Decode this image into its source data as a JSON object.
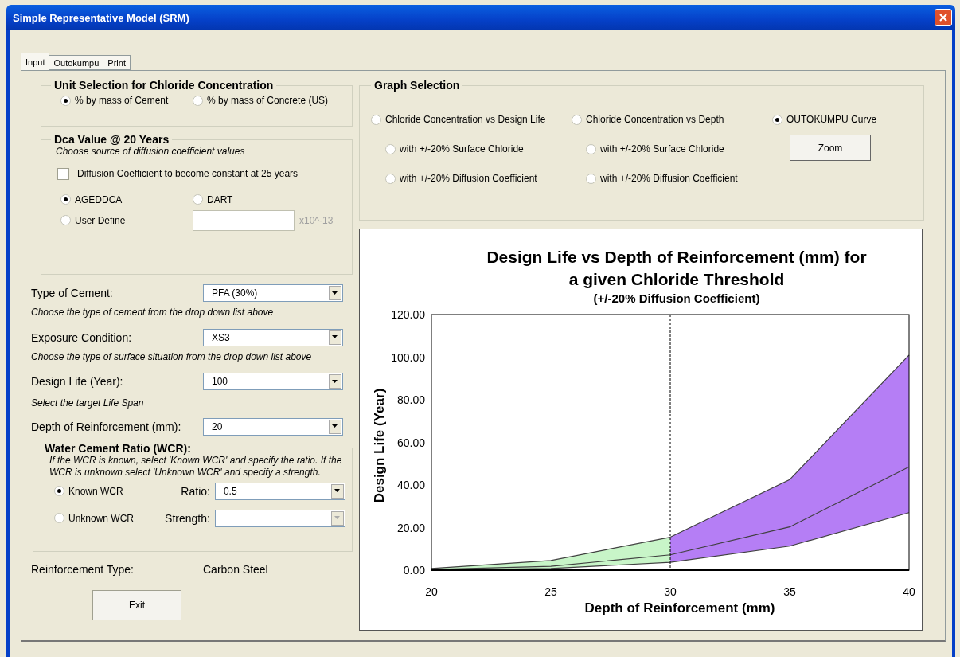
{
  "window": {
    "title": "Simple Representative Model (SRM)"
  },
  "tabs": [
    {
      "label": "Input",
      "selected": true
    },
    {
      "label": "Outokumpu",
      "selected": false
    },
    {
      "label": "Print",
      "selected": false
    }
  ],
  "unit_selection": {
    "title": "Unit Selection for Chloride Concentration",
    "options": [
      {
        "label": "% by mass of Cement",
        "selected": true
      },
      {
        "label": "% by mass of Concrete (US)",
        "selected": false
      }
    ]
  },
  "dca": {
    "title": "Dca Value @ 20 Years",
    "hint": "Choose source of diffusion coefficient values",
    "constant_checkbox": {
      "label": "Diffusion Coefficient to become constant at 25 years",
      "checked": false
    },
    "options": [
      {
        "label": "AGEDDCA",
        "selected": true
      },
      {
        "label": "DART",
        "selected": false
      },
      {
        "label": "User Define",
        "selected": false
      }
    ],
    "unit": "x10^-13"
  },
  "fields": [
    {
      "label": "Type of Cement:",
      "value": "PFA (30%)",
      "hint": "Choose the type of cement from the drop down list above"
    },
    {
      "label": "Exposure Condition:",
      "value": "XS3",
      "hint": "Choose the type of surface situation from the drop down list above"
    },
    {
      "label": "Design Life (Year):",
      "value": "100",
      "hint": "Select the target Life Span"
    },
    {
      "label": "Depth of Reinforcement (mm):",
      "value": "20"
    }
  ],
  "wcr": {
    "title": "Water Cement Ratio (WCR):",
    "hint": "If the WCR is known, select 'Known WCR' and specify the ratio. If the WCR is unknown select 'Unknown WCR' and specify a strength.",
    "options": [
      {
        "label": "Known WCR",
        "selected": true,
        "field_label": "Ratio:",
        "value": "0.5",
        "disabled": false
      },
      {
        "label": "Unknown WCR",
        "selected": false,
        "field_label": "Strength:",
        "disabled": true
      }
    ]
  },
  "reinforcement": {
    "label": "Reinforcement Type:",
    "value": "Carbon Steel"
  },
  "exit_button": "Exit",
  "graph_selection": {
    "title": "Graph Selection",
    "groups": [
      {
        "label": "Chloride Concentration vs Design Life",
        "selected": false,
        "children": [
          {
            "label": "with +/-20% Surface Chloride",
            "selected": false
          },
          {
            "label": "with +/-20% Diffusion Coefficient",
            "selected": false
          }
        ]
      },
      {
        "label": "Chloride Concentration vs Depth",
        "selected": false,
        "children": [
          {
            "label": "with +/-20% Surface Chloride",
            "selected": false
          },
          {
            "label": "with +/-20% Diffusion Coefficient",
            "selected": false
          }
        ]
      },
      {
        "label": "OUTOKUMPU Curve",
        "selected": true
      }
    ],
    "zoom_button": "Zoom"
  },
  "chart": {
    "chart_data": {
      "type": "area",
      "title": "Design Life vs Depth of Reinforcement (mm) for a given Chloride Threshold",
      "subtitle": "(+/-20% Diffusion Coefficient)",
      "xlabel": "Depth of Reinforcement (mm)",
      "ylabel": "Design Life (Year)",
      "x": [
        20,
        25,
        30,
        35,
        40
      ],
      "series": [
        {
          "type": "area",
          "color": "#c8f5c8",
          "values": [
            0.8,
            4.5,
            15.5,
            null,
            null
          ]
        },
        {
          "type": "area",
          "color": "#b57ef5",
          "values": [
            null,
            null,
            15.5,
            42.5,
            101
          ]
        },
        {
          "type": "line",
          "color": "#404040",
          "values": [
            0.3,
            1.8,
            7.2,
            20.3,
            48.5
          ]
        },
        {
          "type": "line",
          "color": "#404040",
          "values": [
            0.1,
            0.8,
            3.7,
            11.3,
            27
          ]
        }
      ],
      "xlim": [
        20,
        40
      ],
      "ylim": [
        0,
        120
      ],
      "xticks": [
        20,
        25,
        30,
        35,
        40
      ],
      "yticks": [
        {
          "value": 0,
          "label": "0.00"
        },
        {
          "value": 20,
          "label": "20.00"
        },
        {
          "value": 40,
          "label": "40.00"
        },
        {
          "value": 60,
          "label": "60.00"
        },
        {
          "value": 80,
          "label": "80.00"
        },
        {
          "value": 100,
          "label": "100.00"
        },
        {
          "value": 120,
          "label": "120.00"
        }
      ],
      "ref_lines": [
        {
          "axis": "x",
          "value": 30
        }
      ]
    }
  }
}
